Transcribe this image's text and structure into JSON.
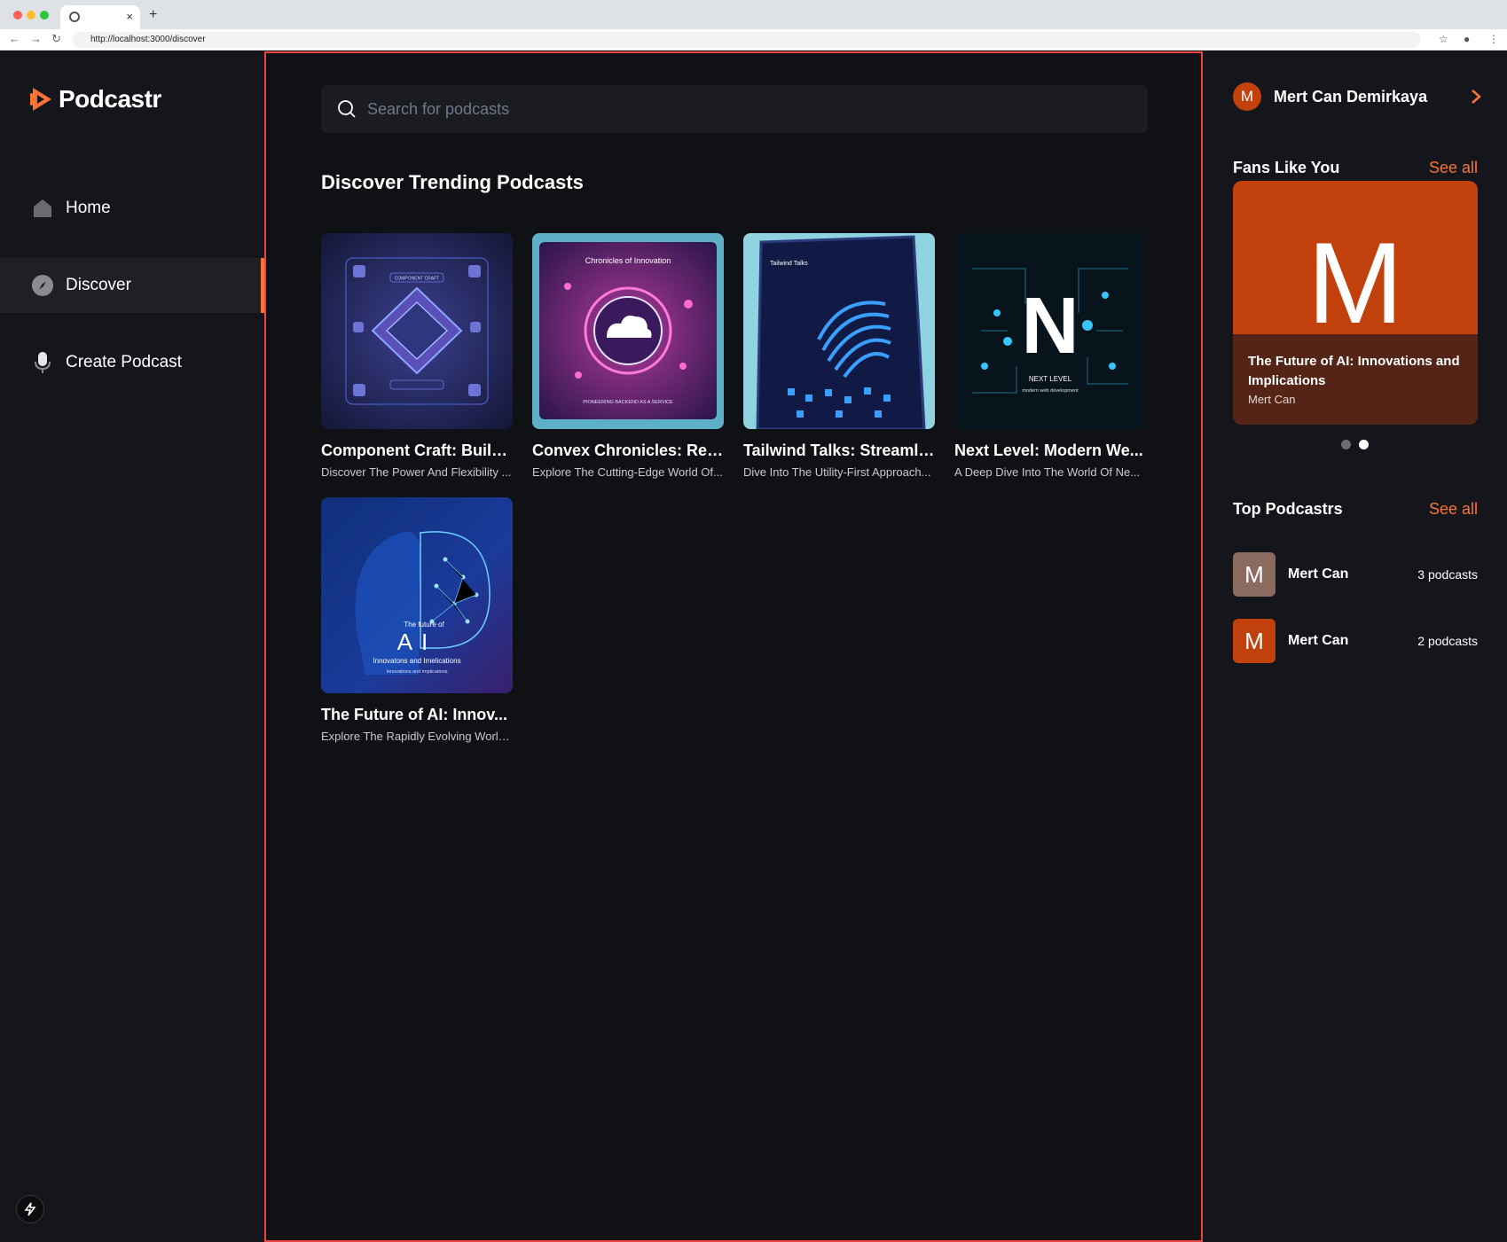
{
  "browser": {
    "url": "http://localhost:3000/discover",
    "tab_close": "×",
    "new_tab": "+"
  },
  "sidebar": {
    "logo": "Podcastr",
    "items": [
      {
        "label": "Home",
        "icon": "home-icon",
        "active": false
      },
      {
        "label": "Discover",
        "icon": "compass-icon",
        "active": true
      },
      {
        "label": "Create Podcast",
        "icon": "microphone-icon",
        "active": false
      }
    ]
  },
  "search": {
    "placeholder": "Search for podcasts",
    "value": ""
  },
  "main": {
    "title": "Discover Trending Podcasts",
    "podcasts": [
      {
        "title": "Component Craft: Build...",
        "description": "Discover The Power And Flexibility ...",
        "cover_text": "COMPONENT CRAFT"
      },
      {
        "title": "Convex Chronicles: Rev...",
        "description": "Explore The Cutting-Edge World Of...",
        "cover_text": "Chronicles of Innovation",
        "cover_subtext": "PIONEERING BACKEND AS A SERVICE"
      },
      {
        "title": "Tailwind Talks: Streamli...",
        "description": "Dive Into The Utility-First Approach...",
        "cover_text": "Tailwind Talks"
      },
      {
        "title": "Next Level: Modern We...",
        "description": "A Deep Dive Into The World Of Ne...",
        "cover_text": "NEXT LEVEL",
        "cover_subtext": "modern web development"
      },
      {
        "title": "The Future of AI: Innov...",
        "description": "Explore The Rapidly Evolving World...",
        "cover_text": "The future of",
        "cover_big": "AI",
        "cover_subtext": "Innovatons and Imelications",
        "cover_subtext2": "Innovations and implications"
      }
    ]
  },
  "right": {
    "user": {
      "initial": "M",
      "name": "Mert Can Demirkaya"
    },
    "fans": {
      "title": "Fans Like You",
      "see_all": "See all",
      "card": {
        "letter": "M",
        "title": "The Future of AI: Innovations and Implications",
        "author": "Mert Can"
      },
      "slide_count": 2,
      "active_slide": 2
    },
    "top": {
      "title": "Top Podcastrs",
      "see_all": "See all",
      "items": [
        {
          "initial": "M",
          "name": "Mert Can",
          "count": "3 podcasts",
          "color": "#8b6a60"
        },
        {
          "initial": "M",
          "name": "Mert Can",
          "count": "2 podcasts",
          "color": "#c2400c"
        }
      ]
    }
  },
  "colors": {
    "accent": "#f97535",
    "active_border": "#ef4444",
    "brand_orange": "#c2400c"
  }
}
